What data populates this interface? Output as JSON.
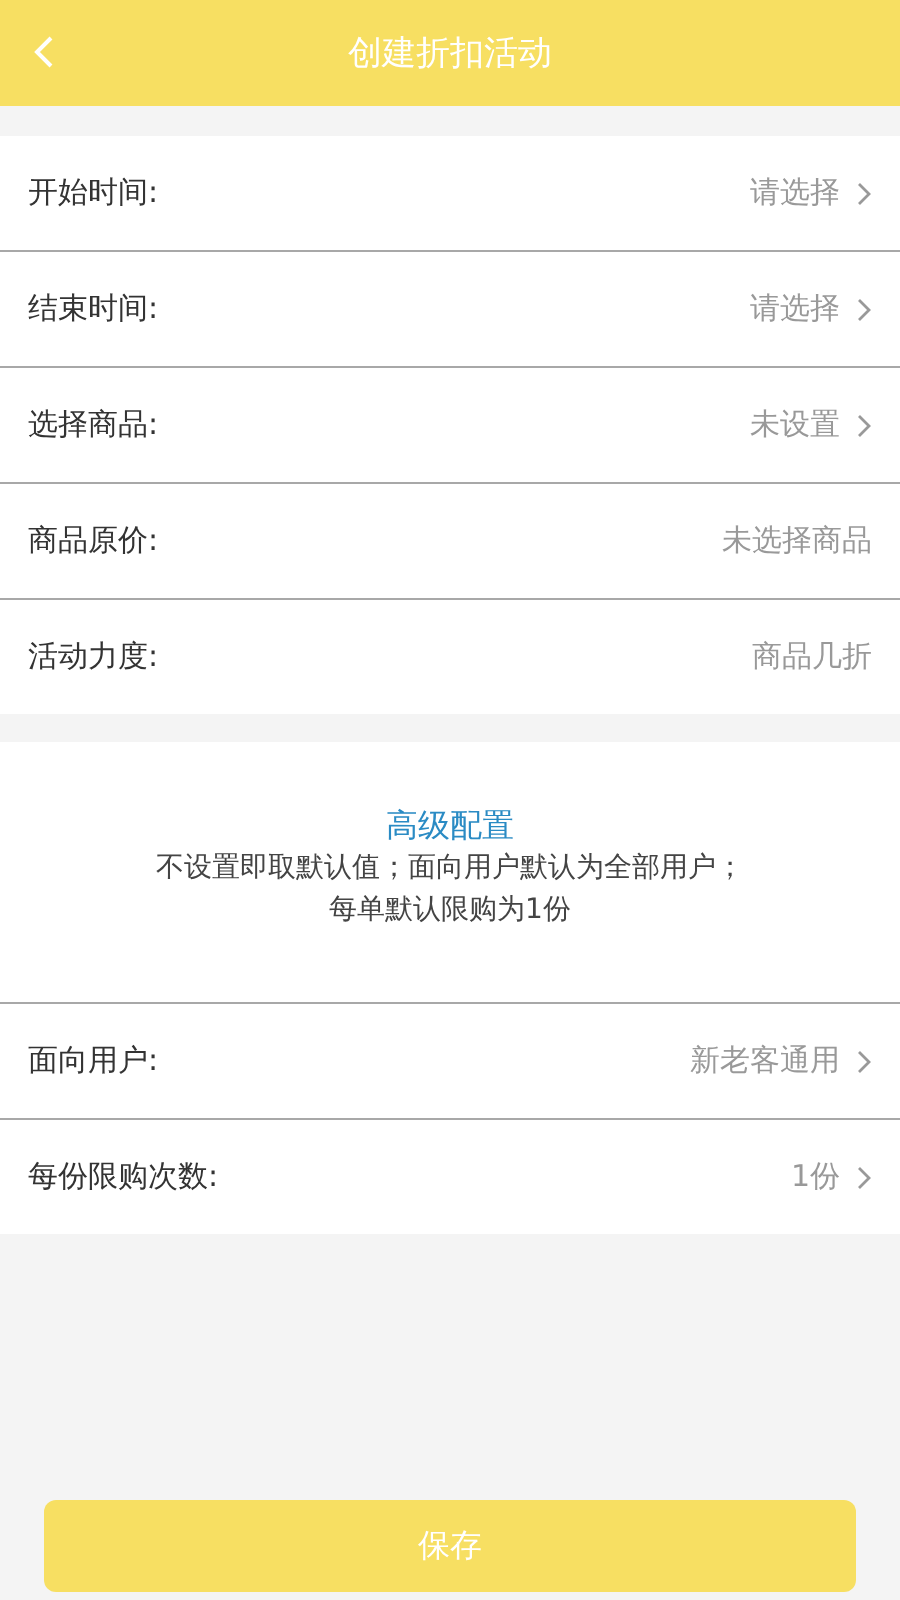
{
  "header": {
    "title": "创建折扣活动"
  },
  "basic_rows": [
    {
      "label": "开始时间:",
      "value": "请选择",
      "kind": "select"
    },
    {
      "label": "结束时间:",
      "value": "请选择",
      "kind": "select"
    },
    {
      "label": "选择商品:",
      "value": "未设置",
      "kind": "select"
    },
    {
      "label": "商品原价:",
      "value": "未选择商品",
      "kind": "display"
    },
    {
      "label": "活动力度:",
      "value": "商品几折",
      "kind": "display"
    }
  ],
  "advanced": {
    "title": "高级配置",
    "note_lines": [
      "不设置即取默认值；面向用户默认为全部用户；",
      "每单默认限购为1份"
    ],
    "rows": [
      {
        "label": "面向用户:",
        "value": "新老客通用",
        "kind": "select"
      },
      {
        "label": "每份限购次数:",
        "value": "1份",
        "kind": "select"
      }
    ]
  },
  "save_button": "保存"
}
